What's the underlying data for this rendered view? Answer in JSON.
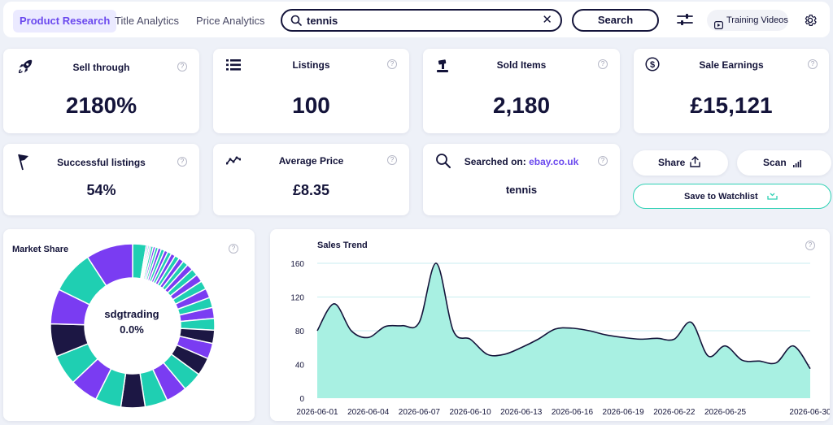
{
  "nav": {
    "tabs": [
      {
        "label": "Product Research"
      },
      {
        "label": "Title Analytics"
      },
      {
        "label": "Price Analytics"
      }
    ],
    "search": {
      "value": "tennis"
    },
    "search_button": "Search",
    "training_videos": "Training Videos"
  },
  "stats": {
    "sell_through": {
      "label": "Sell through",
      "value": "2180%"
    },
    "listings": {
      "label": "Listings",
      "value": "100"
    },
    "sold_items": {
      "label": "Sold Items",
      "value": "2,180"
    },
    "sale_earnings": {
      "label": "Sale Earnings",
      "value": "£15,121"
    },
    "successful_listings": {
      "label": "Successful listings",
      "value": "54%"
    },
    "average_price": {
      "label": "Average Price",
      "value": "£8.35"
    },
    "searched_on": {
      "label": "Searched on:",
      "site": "ebay.co.uk",
      "query": "tennis"
    }
  },
  "actions": {
    "share": "Share",
    "scan": "Scan",
    "save_to_watchlist": "Save to Watchlist"
  },
  "market_share": {
    "title": "Market Share",
    "center_name": "sdgtrading",
    "center_pct": "0.0%",
    "colors": [
      "#7a3cf2",
      "#1fcfb2",
      "#1c1744",
      "#ffffff"
    ]
  },
  "chart_data": {
    "type": "area",
    "title": "Sales Trend",
    "x": [
      "2026-06-01",
      "2026-06-02",
      "2026-06-03",
      "2026-06-04",
      "2026-06-05",
      "2026-06-06",
      "2026-06-07",
      "2026-06-08",
      "2026-06-09",
      "2026-06-10",
      "2026-06-11",
      "2026-06-12",
      "2026-06-13",
      "2026-06-14",
      "2026-06-15",
      "2026-06-16",
      "2026-06-17",
      "2026-06-18",
      "2026-06-19",
      "2026-06-20",
      "2026-06-21",
      "2026-06-22",
      "2026-06-23",
      "2026-06-24",
      "2026-06-25",
      "2026-06-26",
      "2026-06-27",
      "2026-06-28",
      "2026-06-29",
      "2026-06-30"
    ],
    "values": [
      80,
      112,
      80,
      72,
      85,
      86,
      90,
      160,
      80,
      70,
      52,
      52,
      60,
      70,
      82,
      83,
      80,
      75,
      72,
      70,
      71,
      70,
      90,
      50,
      62,
      45,
      44,
      42,
      62,
      35
    ],
    "xticks": [
      "2026-06-01",
      "2026-06-04",
      "2026-06-07",
      "2026-06-10",
      "2026-06-13",
      "2026-06-16",
      "2026-06-19",
      "2026-06-22",
      "2026-06-25",
      "2026-06-30"
    ],
    "yticks": [
      0,
      40,
      80,
      120,
      160
    ],
    "ylim": [
      0,
      160
    ],
    "grid": true,
    "colors": {
      "fill": "#a8f0e2",
      "line": "#14143a",
      "grid": "#c9eef0"
    }
  }
}
